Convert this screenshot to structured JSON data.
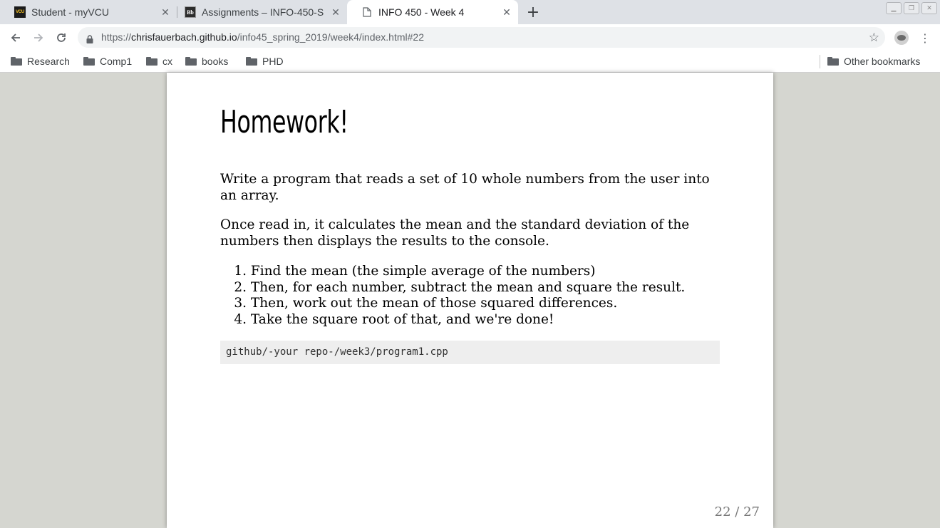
{
  "browser": {
    "tabs": [
      {
        "title": "Student - myVCU",
        "favicon": "VCU",
        "active": false
      },
      {
        "title": "Assignments – INFO-450-S",
        "favicon": "Bb",
        "active": false
      },
      {
        "title": "INFO 450 - Week 4",
        "favicon": "page-icon",
        "active": true
      }
    ],
    "url": {
      "scheme": "https://",
      "host": "chrisfauerbach.github.io",
      "path": "/info45_spring_2019/week4/index.html#22"
    }
  },
  "bookmarks": {
    "items": [
      {
        "label": "Research"
      },
      {
        "label": "Comp1"
      },
      {
        "label": "cx"
      },
      {
        "label": "books"
      },
      {
        "label": "PHD"
      }
    ],
    "other": "Other bookmarks"
  },
  "slide": {
    "title": "Homework!",
    "paragraph1": "Write a program that reads a set of 10 whole numbers from the user into an array.",
    "paragraph2": "Once read in, it calculates the mean and the standard deviation of the numbers then displays the results to the console.",
    "steps": [
      {
        "num": "1.",
        "text": "Find the mean (the simple average of the numbers)"
      },
      {
        "num": "2.",
        "text": "Then, for each number, subtract the mean and square the result."
      },
      {
        "num": "3.",
        "text": "Then, work out the mean of those squared differences."
      },
      {
        "num": "4.",
        "text": "Take the square root of that, and we're done!"
      }
    ],
    "code": "github/-your repo-/week3/program1.cpp",
    "page_indicator": "22 / 27"
  },
  "colors": {
    "background": "#d5d6d0",
    "tabstrip": "#dee1e6",
    "code_bg": "#eeeeee"
  }
}
